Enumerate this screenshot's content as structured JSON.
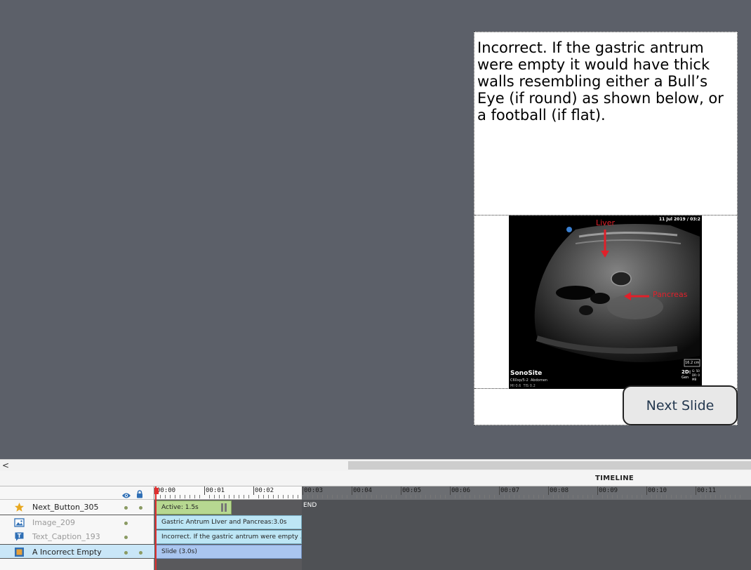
{
  "slide": {
    "caption_text": "Incorrect. If the gastric antrum were empty it would have thick walls resembling either a Bull’s Eye (if round) as shown below, or a football (if flat).",
    "image": {
      "date_stamp": "11 Jul 2019 / 03:2",
      "label_liver": "Liver",
      "label_pancreas": "Pancreas",
      "brand": "SonoSite",
      "probe_info": "C60xp/5-2  Abdomen",
      "mi_info": "MI 0.6  TIS 0.2",
      "depth": "16.2 cm",
      "mode": "2D:",
      "mode_sub": "Gen",
      "params": "G: 50\nDR: 0\nMB",
      "annotation_color": "#e0202a"
    },
    "next_button_label": "Next Slide"
  },
  "scrollbar": {
    "left_arrow": "<"
  },
  "timeline": {
    "title": "TIMELINE",
    "layers": [
      {
        "name": "Next_Button_305",
        "icon": "star-icon",
        "dim": false
      },
      {
        "name": "Image_209",
        "icon": "image-icon",
        "dim": true
      },
      {
        "name": "Text_Caption_193",
        "icon": "text-caption-icon",
        "dim": true
      },
      {
        "name": "A Incorrect Empty",
        "icon": "slide-icon",
        "dim": false
      }
    ],
    "ruler_labels": [
      "00:00",
      "00:01",
      "00:02",
      "00:03",
      "00:04",
      "00:05",
      "00:06",
      "00:07",
      "00:08",
      "00:09",
      "00:10",
      "00:11"
    ],
    "bars": {
      "button": "Active: 1.5s",
      "image": "Gastric Antrum LIver and Pancreas:3.0s",
      "caption": "Incorrect. If the gastric antrum were empty ...",
      "slide": "Slide (3.0s)"
    },
    "end_label": "END"
  }
}
